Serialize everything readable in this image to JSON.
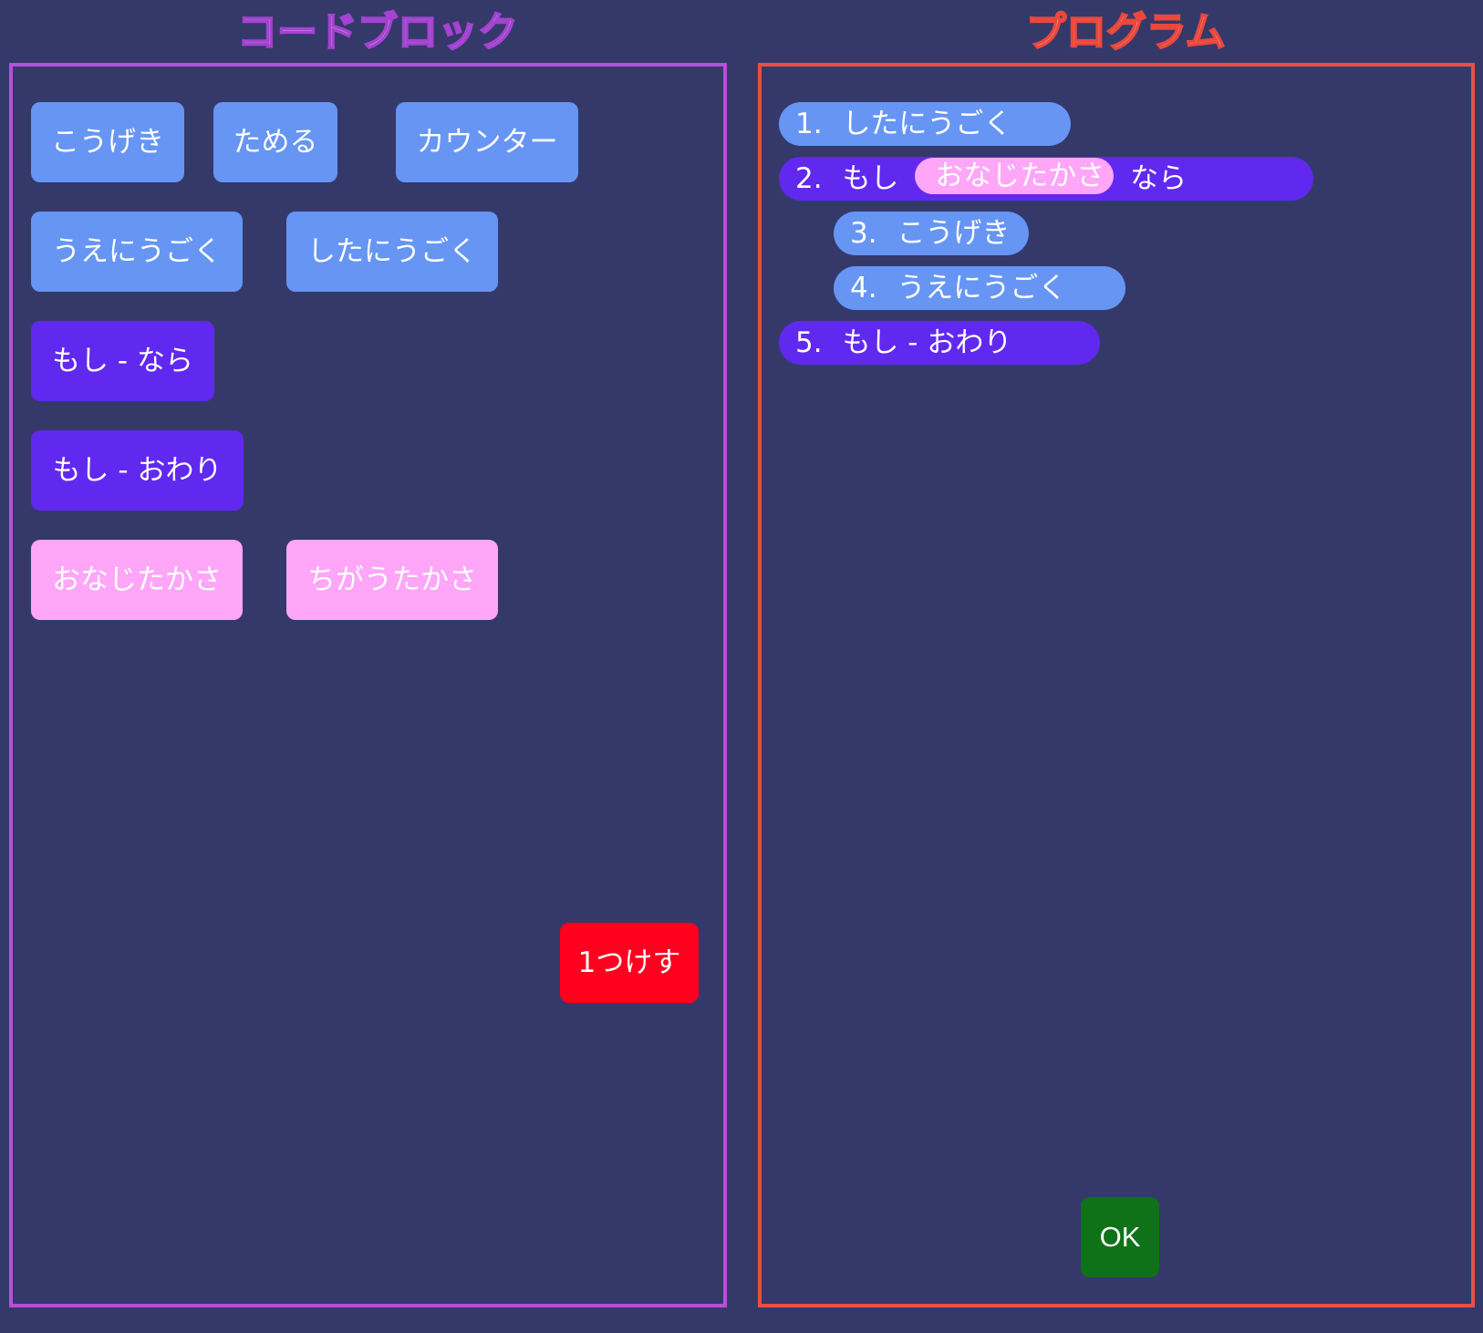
{
  "headers": {
    "blocks_title": "コードブロック",
    "program_title": "プログラム"
  },
  "code_blocks": {
    "attack": "こうげき",
    "charge": "ためる",
    "counter": "カウンター",
    "move_up": "うえにうごく",
    "move_down": "したにうごく",
    "if_then": "もし - なら",
    "if_end": "もし - おわり",
    "same_height": "おなじたかさ",
    "different_height": "ちがうたかさ"
  },
  "delete_button": "1つけす",
  "program": {
    "lines": [
      {
        "num": "1.",
        "text": "したにうごく"
      },
      {
        "num": "2.",
        "prefix": "もし",
        "condition": "おなじたかさ",
        "suffix": "なら"
      },
      {
        "num": "3.",
        "text": "こうげき"
      },
      {
        "num": "4.",
        "text": "うえにうごく"
      },
      {
        "num": "5.",
        "text": "もし - おわり"
      }
    ]
  },
  "ok_button": "OK",
  "colors": {
    "background": "#34396a",
    "blocks_border": "#b84ed8",
    "program_border": "#e85044",
    "action_block": "#6695f4",
    "if_block": "#6128f0",
    "condition_block": "#ffa6f8",
    "delete_button": "#ff001e",
    "ok_button": "#0f7219"
  }
}
